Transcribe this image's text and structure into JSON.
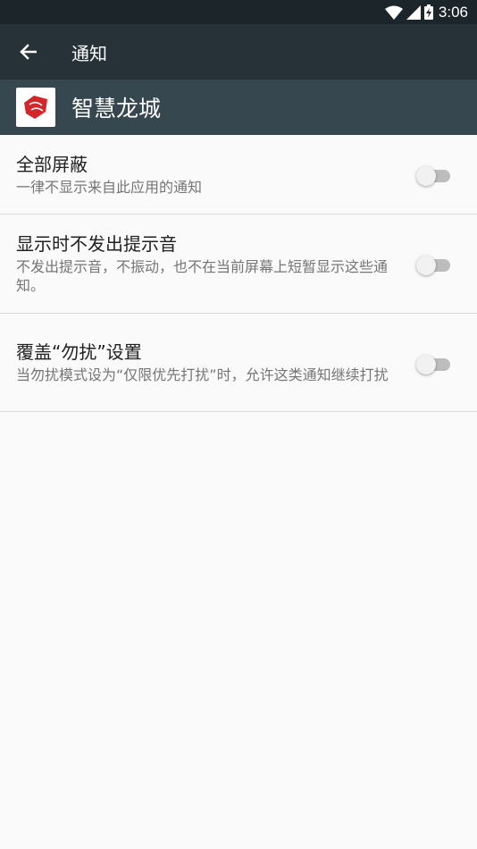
{
  "status_bar": {
    "time": "3:06"
  },
  "toolbar": {
    "title": "通知"
  },
  "app": {
    "name": "智慧龙城"
  },
  "settings": [
    {
      "title": "全部屏蔽",
      "subtitle": "一律不显示来自此应用的通知",
      "enabled": false
    },
    {
      "title": "显示时不发出提示音",
      "subtitle": "不发出提示音，不振动，也不在当前屏幕上短暂显示这些通知。",
      "enabled": false
    },
    {
      "title": "覆盖“勿扰”设置",
      "subtitle": "当勿扰模式设为“仅限优先打扰”时，允许这类通知继续打扰",
      "enabled": false
    }
  ]
}
